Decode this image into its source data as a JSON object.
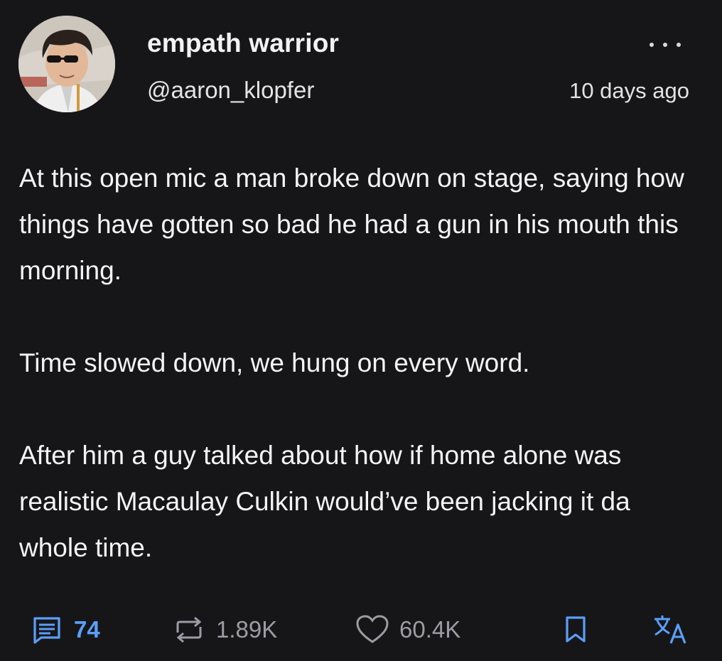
{
  "post": {
    "display_name": "empath warrior",
    "handle": "@aaron_klopfer",
    "timestamp": "10 days ago",
    "body": [
      "At this open mic a man broke down on stage, saying how things have gotten so bad he had a gun in his mouth this morning.",
      "Time slowed down, we hung on every word.",
      "After him a guy talked about how if home alone was realistic Macaulay Culkin would’ve been jacking it da whole time."
    ]
  },
  "actions": {
    "replies": {
      "icon": "reply-bubble-icon",
      "count": "74"
    },
    "reposts": {
      "icon": "repost-icon",
      "count": "1.89K"
    },
    "likes": {
      "icon": "heart-icon",
      "count": "60.4K"
    },
    "bookmark": {
      "icon": "bookmark-icon"
    },
    "translate": {
      "icon": "translate-icon"
    }
  },
  "colors": {
    "background": "#161619",
    "text": "#f4f4f6",
    "accent": "#5b9ff7",
    "muted": "#9c9ca4"
  }
}
